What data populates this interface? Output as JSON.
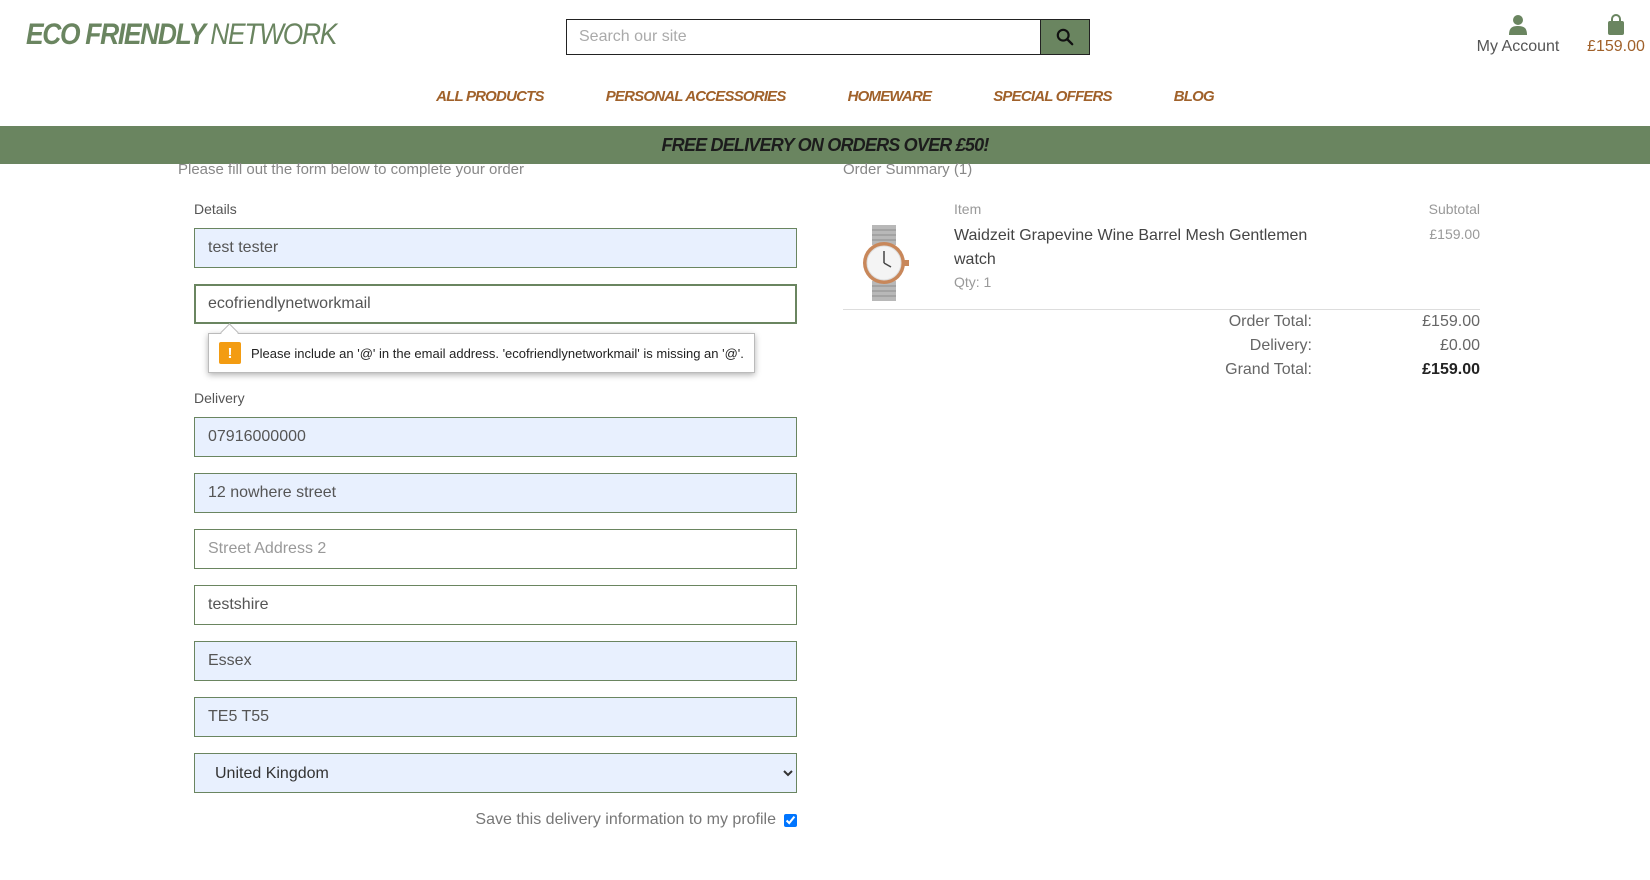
{
  "header": {
    "logo_bold": "ECO FRIENDLY",
    "logo_light": "NETWORK",
    "search_placeholder": "Search our site",
    "account_label": "My Account",
    "bag_total": "£159.00"
  },
  "nav": {
    "items": [
      "ALL PRODUCTS",
      "PERSONAL ACCESSORIES",
      "HOMEWARE",
      "SPECIAL OFFERS",
      "BLOG"
    ]
  },
  "banner": {
    "text": "FREE DELIVERY ON ORDERS OVER £50!"
  },
  "form": {
    "intro": "Please fill out the form below to complete your order",
    "details_label": "Details",
    "full_name": "test tester",
    "email": "ecofriendlynetworkmail",
    "email_error": "Please include an '@' in the email address. 'ecofriendlynetworkmail' is missing an '@'.",
    "delivery_label": "Delivery",
    "phone": "07916000000",
    "street1": "12 nowhere street",
    "street2_placeholder": "Street Address 2",
    "town": "testshire",
    "county": "Essex",
    "postcode": "TE5 T55",
    "country": "United Kingdom",
    "save_info_label": "Save this delivery information to my profile",
    "save_info_checked": true
  },
  "summary": {
    "title": "Order Summary (1)",
    "col_item": "Item",
    "col_subtotal": "Subtotal",
    "product_name": "Waidzeit Grapevine Wine Barrel Mesh Gentlemen watch",
    "quantity": "Qty: 1",
    "product_subtotal": "£159.00",
    "order_total_label": "Order Total:",
    "order_total": "£159.00",
    "delivery_label": "Delivery:",
    "delivery": "£0.00",
    "grand_total_label": "Grand Total:",
    "grand_total": "£159.00"
  },
  "colors": {
    "brand_green": "#6a8560",
    "accent_brown": "#a0612a",
    "autofill_blue": "#e8f0fe"
  },
  "icons": [
    "search-icon",
    "user-icon",
    "shopping-bag-icon",
    "warning-icon"
  ]
}
